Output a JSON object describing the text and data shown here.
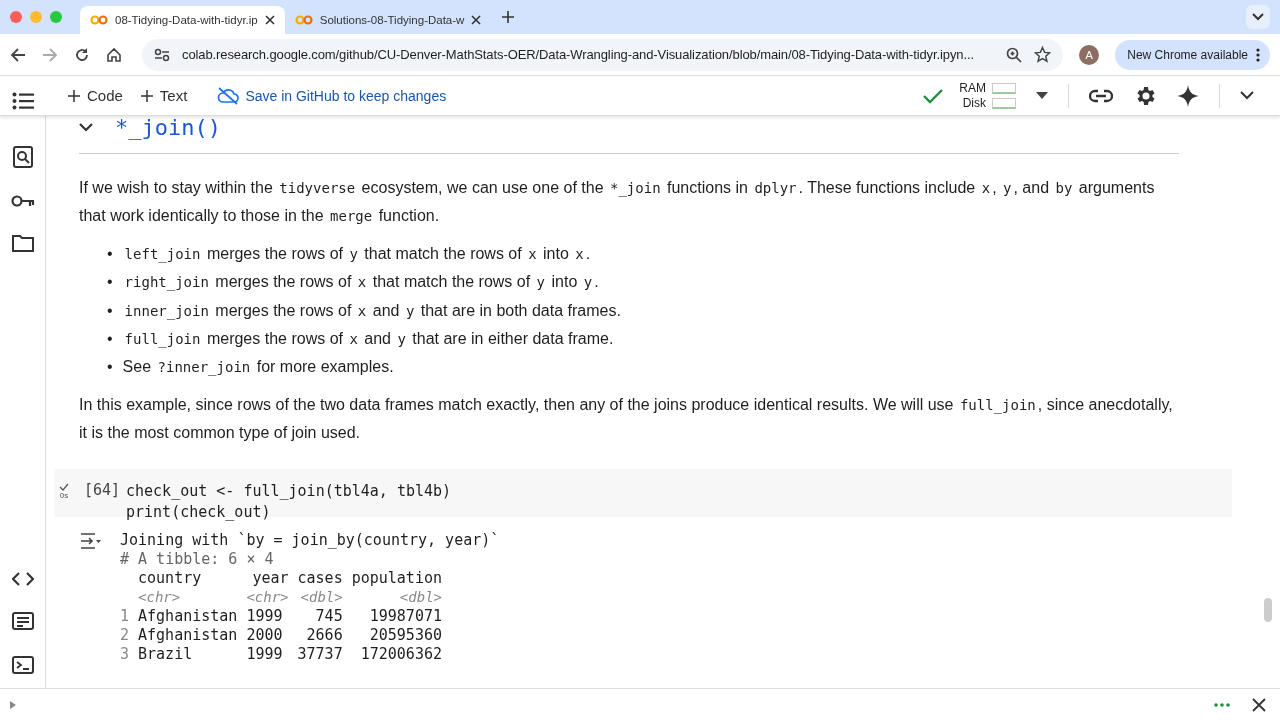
{
  "browser": {
    "tabs": [
      {
        "title": "08-Tidying-Data-with-tidyr.ip",
        "selected": true
      },
      {
        "title": "Solutions-08-Tidying-Data-w",
        "selected": false
      }
    ],
    "url": "colab.research.google.com/github/CU-Denver-MathStats-OER/Data-Wrangling-and-Visualization/blob/main/08-Tidying-Data-with-tidyr.ipyn...",
    "avatar": "A",
    "update_button": "New Chrome available"
  },
  "toolbar": {
    "add_code": "Code",
    "add_text": "Text",
    "save_link": "Save in GitHub to keep changes",
    "ram_label": "RAM",
    "disk_label": "Disk"
  },
  "section": {
    "heading": "*_join()",
    "expanded": true
  },
  "paragraphs": [
    [
      {
        "t": "If we wish to stay within the "
      },
      {
        "t": "tidyverse",
        "code": true
      },
      {
        "t": " ecosystem, we can use one of the "
      },
      {
        "t": "*_join",
        "code": true
      },
      {
        "t": " functions in "
      },
      {
        "t": "dplyr",
        "code": true
      },
      {
        "t": ". These functions include "
      },
      {
        "t": "x",
        "code": true
      },
      {
        "t": ", "
      },
      {
        "t": "y",
        "code": true
      },
      {
        "t": ", and "
      },
      {
        "t": "by",
        "code": true
      },
      {
        "t": " arguments that work identically to those in the "
      },
      {
        "t": "merge",
        "code": true
      },
      {
        "t": " function."
      }
    ]
  ],
  "bullets": [
    {
      "marker": "•",
      "parts": [
        {
          "t": "left_join",
          "code": true
        },
        {
          "t": " merges the rows of "
        },
        {
          "t": "y",
          "code": true
        },
        {
          "t": " that match the rows of "
        },
        {
          "t": "x",
          "code": true
        },
        {
          "t": " into "
        },
        {
          "t": "x",
          "code": true
        },
        {
          "t": "."
        }
      ]
    },
    {
      "marker": "•",
      "parts": [
        {
          "t": "right_join",
          "code": true
        },
        {
          "t": " merges the rows of "
        },
        {
          "t": "x",
          "code": true
        },
        {
          "t": " that match the rows of "
        },
        {
          "t": "y",
          "code": true
        },
        {
          "t": " into "
        },
        {
          "t": "y",
          "code": true
        },
        {
          "t": "."
        }
      ]
    },
    {
      "marker": "•",
      "parts": [
        {
          "t": "inner_join",
          "code": true
        },
        {
          "t": " merges the rows of "
        },
        {
          "t": "x",
          "code": true
        },
        {
          "t": " and "
        },
        {
          "t": "y",
          "code": true
        },
        {
          "t": " that are in both data frames."
        }
      ]
    },
    {
      "marker": "•",
      "parts": [
        {
          "t": "full_join",
          "code": true
        },
        {
          "t": " merges the rows of "
        },
        {
          "t": "x",
          "code": true
        },
        {
          "t": " and "
        },
        {
          "t": "y",
          "code": true
        },
        {
          "t": " that are in either data frame."
        }
      ]
    },
    {
      "marker": "•",
      "parts": [
        {
          "t": "See "
        },
        {
          "t": "?inner_join",
          "code": true
        },
        {
          "t": " for more examples."
        }
      ]
    }
  ],
  "paragraphs_after": [
    [
      {
        "t": "In this example, since rows of the two data frames match exactly, then any of the joins produce identical results. We will use "
      },
      {
        "t": "full_join",
        "code": true
      },
      {
        "t": ", since anecdotally, it is the most common type of join used."
      }
    ]
  ],
  "cell": {
    "exec_count": "[64]",
    "time": "0s",
    "lines": [
      "check_out <- full_join(tbl4a, tbl4b)",
      "print(check_out)"
    ],
    "output": {
      "message": "Joining with `by = join_by(country, year)`",
      "summary": "# A tibble: 6 × 4",
      "columns": [
        null,
        "country",
        "year",
        "cases",
        "population"
      ],
      "types": [
        "<chr>",
        "<chr>",
        "<dbl>",
        "<dbl>"
      ],
      "rows": [
        [
          "1",
          "Afghanistan",
          "1999",
          "745",
          "19987071"
        ],
        [
          "2",
          "Afghanistan",
          "2000",
          "2666",
          "20595360"
        ],
        [
          "3",
          "Brazil",
          "1999",
          "37737",
          "172006362"
        ]
      ]
    }
  }
}
